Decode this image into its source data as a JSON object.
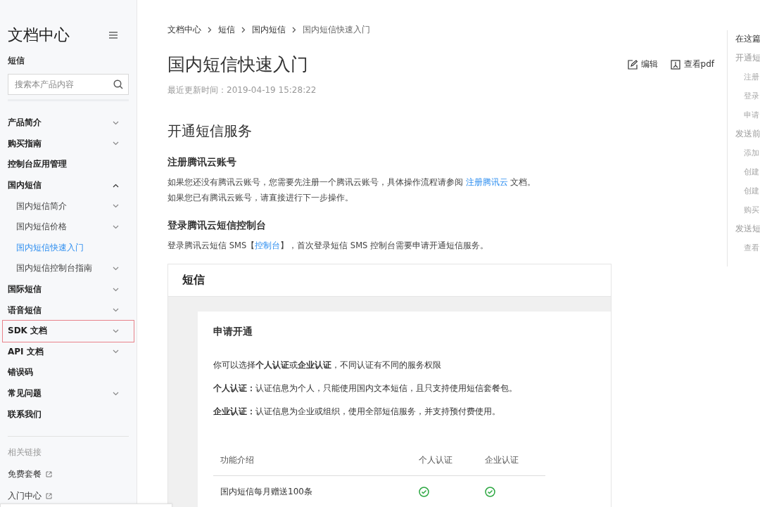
{
  "sidebar": {
    "title": "文档中心",
    "product": "短信",
    "search": {
      "placeholder": "搜索本产品内容"
    },
    "items": [
      {
        "kind": "group",
        "label": "产品简介",
        "expanded": false,
        "selected": false,
        "highlighted": false
      },
      {
        "kind": "group",
        "label": "购买指南",
        "expanded": false,
        "selected": false,
        "highlighted": false
      },
      {
        "kind": "link",
        "label": "控制台应用管理",
        "selected": false,
        "highlighted": false
      },
      {
        "kind": "group",
        "label": "国内短信",
        "expanded": true,
        "selected": false,
        "highlighted": false,
        "children": [
          {
            "kind": "group",
            "label": "国内短信简介",
            "expanded": false,
            "selected": false,
            "highlighted": false
          },
          {
            "kind": "group",
            "label": "国内短信价格",
            "expanded": false,
            "selected": false,
            "highlighted": false
          },
          {
            "kind": "link",
            "label": "国内短信快速入门",
            "selected": true,
            "highlighted": false
          },
          {
            "kind": "group",
            "label": "国内短信控制台指南",
            "expanded": false,
            "selected": false,
            "highlighted": false
          }
        ]
      },
      {
        "kind": "group",
        "label": "国际短信",
        "expanded": false,
        "selected": false,
        "highlighted": false
      },
      {
        "kind": "group",
        "label": "语音短信",
        "expanded": false,
        "selected": false,
        "highlighted": false
      },
      {
        "kind": "group",
        "label": "SDK 文档",
        "expanded": false,
        "selected": false,
        "highlighted": true
      },
      {
        "kind": "group",
        "label": "API 文档",
        "expanded": false,
        "selected": false,
        "highlighted": false
      },
      {
        "kind": "link",
        "label": "错误码",
        "selected": false,
        "highlighted": false
      },
      {
        "kind": "group",
        "label": "常见问题",
        "expanded": false,
        "selected": false,
        "highlighted": false
      },
      {
        "kind": "link",
        "label": "联系我们",
        "selected": false,
        "highlighted": false
      }
    ],
    "related_title": "相关链接",
    "related_links": [
      "免费套餐",
      "入门中心"
    ]
  },
  "breadcrumb": [
    "文档中心",
    "短信",
    "国内短信",
    "国内短信快速入门"
  ],
  "page": {
    "title": "国内短信快速入门",
    "updated": "最近更新时间：2019-04-19 15:28:22",
    "actions": [
      {
        "kind": "edit",
        "label": "编辑"
      },
      {
        "kind": "pdf",
        "label": "查看pdf"
      }
    ],
    "section_title": "开通短信服务",
    "blocks": [
      {
        "kind": "heading",
        "text": "注册腾讯云账号"
      },
      {
        "kind": "para",
        "text": "如果您还没有腾讯云账号，您需要先注册一个腾讯云账号，具体操作流程请参阅 ",
        "link": "注册腾讯云",
        "after": " 文档。"
      },
      {
        "kind": "para",
        "text": "如果您已有腾讯云账号，请直接进行下一步操作。"
      },
      {
        "kind": "heading",
        "text": "登录腾讯云短信控制台"
      },
      {
        "kind": "para",
        "text": "登录腾讯云短信 SMS【",
        "link": "控制台",
        "after": "】，首次登录短信 SMS 控制台需要申请开通短信服务。"
      }
    ]
  },
  "screenshot": {
    "title": "短信",
    "panel_title": "申请开通",
    "paragraphs": [
      "你可以选择**个人认证**或**企业认证**，不同认证有不同的服务权限",
      "**个人认证：**认证信息为个人，只能使用国内文本短信，且只支持使用短信套餐包。",
      "**企业认证：**认证信息为企业或组织，使用全部短信服务，并支持预付费使用。"
    ],
    "table": {
      "columns": [
        "功能介绍",
        "个人认证",
        "企业认证"
      ],
      "rows": [
        {
          "feature": "国内短信每月赠送100条",
          "personal": true,
          "enterprise": true
        }
      ]
    }
  },
  "toc": {
    "title": "在这篇",
    "items": [
      {
        "label": "开通短",
        "children": [
          {
            "label": "注册"
          },
          {
            "label": "登录"
          },
          {
            "label": "申请"
          }
        ]
      },
      {
        "label": "发送前",
        "children": [
          {
            "label": "添加"
          },
          {
            "label": "创建"
          },
          {
            "label": "创建"
          },
          {
            "label": "购买"
          }
        ]
      },
      {
        "label": "发送短",
        "children": [
          {
            "label": "查看"
          }
        ]
      }
    ]
  }
}
